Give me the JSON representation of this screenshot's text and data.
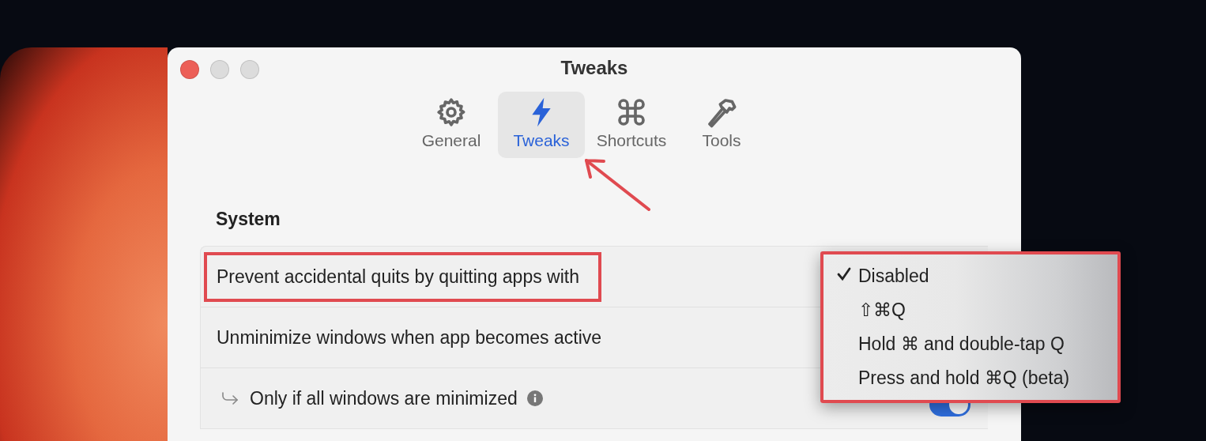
{
  "window": {
    "title": "Tweaks"
  },
  "tabs": [
    {
      "label": "General",
      "selected": false
    },
    {
      "label": "Tweaks",
      "selected": true
    },
    {
      "label": "Shortcuts",
      "selected": false
    },
    {
      "label": "Tools",
      "selected": false
    }
  ],
  "section": {
    "title": "System"
  },
  "rows": [
    {
      "kind": "plain",
      "label": "Prevent accidental quits by quitting apps with",
      "highlighted": true
    },
    {
      "kind": "plain",
      "label": "Unminimize windows when app becomes active",
      "highlighted": false
    },
    {
      "kind": "toggle",
      "label": "Only if all windows are minimized",
      "on": true,
      "highlighted": false
    }
  ],
  "menu": {
    "items": [
      {
        "label": "Disabled",
        "checked": true
      },
      {
        "label": "⇧⌘Q",
        "checked": false
      },
      {
        "label": "Hold ⌘ and double-tap Q",
        "checked": false
      },
      {
        "label": "Press and hold ⌘Q (beta)",
        "checked": false
      }
    ]
  }
}
